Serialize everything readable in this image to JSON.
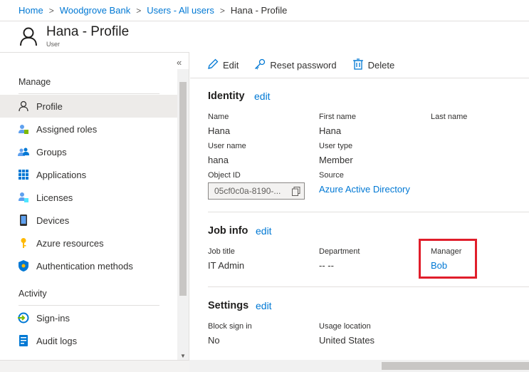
{
  "breadcrumb": {
    "items": [
      "Home",
      "Woodgrove Bank",
      "Users - All users"
    ],
    "current": "Hana - Profile",
    "separator": ">"
  },
  "header": {
    "title": "Hana - Profile",
    "subtitle": "User",
    "icon": "user-icon"
  },
  "sidebar": {
    "collapse": "«",
    "manage_heading": "Manage",
    "manage_items": [
      {
        "label": "Profile",
        "icon": "person-icon",
        "active": true
      },
      {
        "label": "Assigned roles",
        "icon": "roles-icon"
      },
      {
        "label": "Groups",
        "icon": "groups-icon"
      },
      {
        "label": "Applications",
        "icon": "apps-grid-icon"
      },
      {
        "label": "Licenses",
        "icon": "licenses-icon"
      },
      {
        "label": "Devices",
        "icon": "device-icon"
      },
      {
        "label": "Azure resources",
        "icon": "key-icon"
      },
      {
        "label": "Authentication methods",
        "icon": "shield-icon"
      }
    ],
    "activity_heading": "Activity",
    "activity_items": [
      {
        "label": "Sign-ins",
        "icon": "sign-in-icon"
      },
      {
        "label": "Audit logs",
        "icon": "audit-log-icon"
      }
    ]
  },
  "toolbar": {
    "edit": "Edit",
    "reset_password": "Reset password",
    "delete": "Delete"
  },
  "identity": {
    "title": "Identity",
    "edit": "edit",
    "name_label": "Name",
    "name_value": "Hana",
    "first_name_label": "First name",
    "first_name_value": "Hana",
    "last_name_label": "Last name",
    "user_name_label": "User name",
    "user_name_value": "hana",
    "user_type_label": "User type",
    "user_type_value": "Member",
    "object_id_label": "Object ID",
    "object_id_value": "05cf0c0a-8190-...",
    "source_label": "Source",
    "source_value": "Azure Active Directory"
  },
  "job_info": {
    "title": "Job info",
    "edit": "edit",
    "job_title_label": "Job title",
    "job_title_value": "IT Admin",
    "department_label": "Department",
    "department_value": "-- --",
    "manager_label": "Manager",
    "manager_value": "Bob"
  },
  "settings": {
    "title": "Settings",
    "edit": "edit",
    "block_sign_in_label": "Block sign in",
    "block_sign_in_value": "No",
    "usage_location_label": "Usage location",
    "usage_location_value": "United States"
  },
  "colors": {
    "link": "#0078d4",
    "highlight": "#e01e2b",
    "active_bg": "#edebe9"
  }
}
